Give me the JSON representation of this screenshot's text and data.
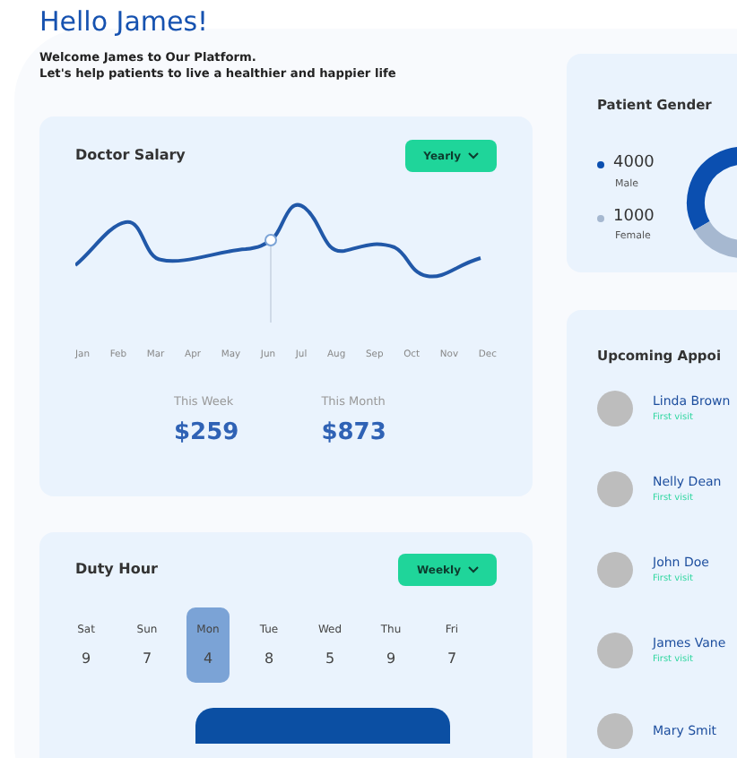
{
  "header": {
    "title": "Hello James!",
    "subtitle_lines": [
      "Welcome James to Our Platform.",
      "Let's help patients to live a healthier and happier life"
    ]
  },
  "salary": {
    "title": "Doctor Salary",
    "period": "Yearly",
    "months": [
      "Jan",
      "Feb",
      "Mar",
      "Apr",
      "May",
      "Jun",
      "Jul",
      "Aug",
      "Sep",
      "Oct",
      "Nov",
      "Dec"
    ],
    "stats": [
      {
        "label": "This Week",
        "value": "$259"
      },
      {
        "label": "This Month",
        "value": "$873"
      }
    ]
  },
  "duty": {
    "title": "Duty Hour",
    "period": "Weekly",
    "days": [
      {
        "day": "Sat",
        "hours": "9",
        "selected": false
      },
      {
        "day": "Sun",
        "hours": "7",
        "selected": false
      },
      {
        "day": "Mon",
        "hours": "4",
        "selected": true
      },
      {
        "day": "Tue",
        "hours": "8",
        "selected": false
      },
      {
        "day": "Wed",
        "hours": "5",
        "selected": false
      },
      {
        "day": "Thu",
        "hours": "9",
        "selected": false
      },
      {
        "day": "Fri",
        "hours": "7",
        "selected": false
      }
    ]
  },
  "gender": {
    "title": "Patient Gender",
    "items": [
      {
        "count": "4000",
        "label": "Male",
        "color": "#0b4fb0"
      },
      {
        "count": "1000",
        "label": "Female",
        "color": "#a6b8d0"
      }
    ]
  },
  "appointments": {
    "title": "Upcoming Appoi",
    "items": [
      {
        "name": "Linda Brown",
        "note": "First visit"
      },
      {
        "name": "Nelly Dean",
        "note": "First visit"
      },
      {
        "name": "John Doe",
        "note": "First visit"
      },
      {
        "name": "James Vane",
        "note": "First visit"
      },
      {
        "name": "Mary Smit"
      }
    ]
  }
}
